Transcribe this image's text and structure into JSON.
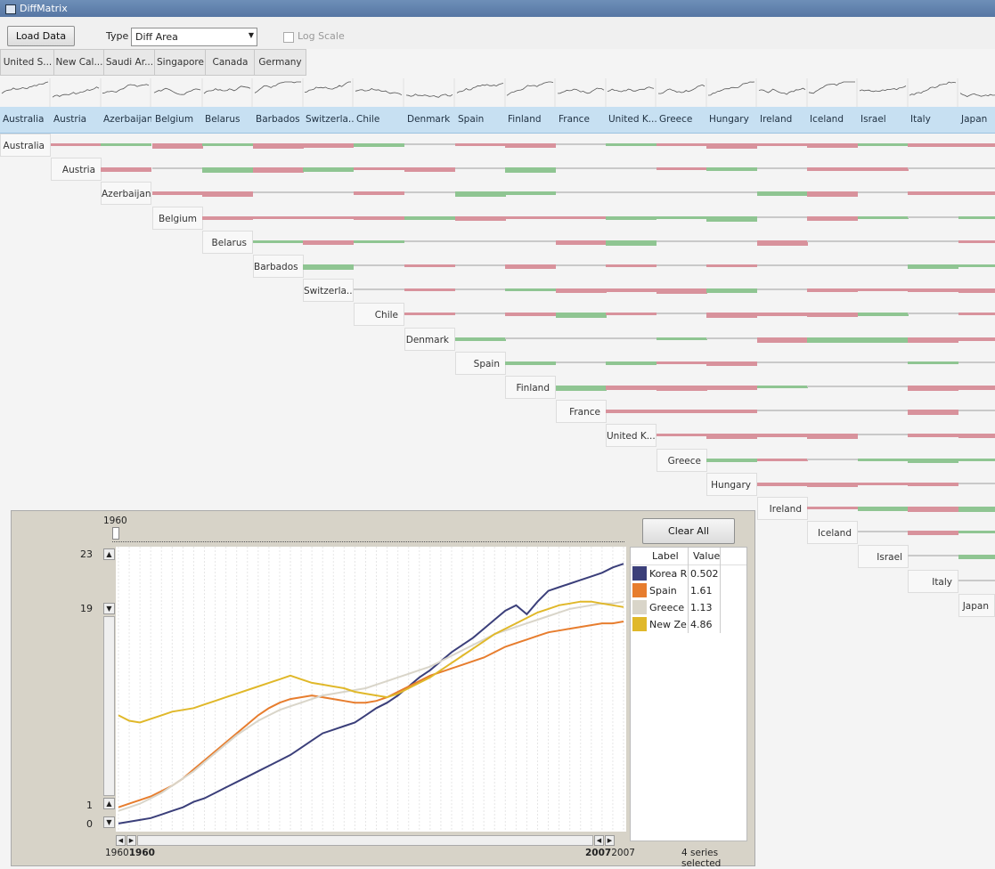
{
  "window": {
    "title": "DiffMatrix"
  },
  "toolbar": {
    "load_label": "Load Data",
    "type_label": "Type",
    "type_value": "Diff Area",
    "log_scale_label": "Log Scale"
  },
  "selected_tabs": [
    "United S...",
    "New Cal...",
    "Saudi Ar...",
    "Singapore",
    "Canada",
    "Germany"
  ],
  "columns": [
    "Australia",
    "Austria",
    "Azerbaijan",
    "Belgium",
    "Belarus",
    "Barbados",
    "Switzerla...",
    "Chile",
    "Denmark",
    "Spain",
    "Finland",
    "France",
    "United K...",
    "Greece",
    "Hungary",
    "Ireland",
    "Iceland",
    "Israel",
    "Italy",
    "Japan"
  ],
  "row_labels": [
    "Australia",
    "Austria",
    "Azerbaijan",
    "Belgium",
    "Belarus",
    "Barbados",
    "Switzerla...",
    "Chile",
    "Denmark",
    "Spain",
    "Finland",
    "France",
    "United K...",
    "Greece",
    "Hungary",
    "Ireland",
    "Iceland",
    "Israel",
    "Italy",
    "Japan"
  ],
  "colors": {
    "positive": "#d8929c",
    "negative": "#8fc592",
    "neutral": "#c9c9c9",
    "header": "#c7e0f2"
  },
  "detail": {
    "slider_label": "1960",
    "clear_label": "Clear All",
    "y_top": "23",
    "y_upper": "19",
    "y_lower": "1",
    "y_bottom": "0",
    "x_start_prefix": "1960",
    "x_start_bold": "1960",
    "x_end_bold": "2007",
    "x_end_suffix": "2007",
    "status": "4 series selected",
    "legend_header": {
      "label": "Label",
      "value": "Value"
    },
    "legend": [
      {
        "label": "Korea R",
        "value": "0.502",
        "color": "#3b3f7a"
      },
      {
        "label": "Spain",
        "value": "1.61",
        "color": "#e77d2e"
      },
      {
        "label": "Greece",
        "value": "1.13",
        "color": "#d9d5c9"
      },
      {
        "label": "New Ze",
        "value": "4.86",
        "color": "#e0b82a"
      }
    ]
  },
  "chart_data": {
    "type": "line",
    "x": [
      1960,
      1961,
      1962,
      1963,
      1964,
      1965,
      1966,
      1967,
      1968,
      1969,
      1970,
      1971,
      1972,
      1973,
      1974,
      1975,
      1976,
      1977,
      1978,
      1979,
      1980,
      1981,
      1982,
      1983,
      1984,
      1985,
      1986,
      1987,
      1988,
      1989,
      1990,
      1991,
      1992,
      1993,
      1994,
      1995,
      1996,
      1997,
      1998,
      1999,
      2000,
      2001,
      2002,
      2003,
      2004,
      2005,
      2006,
      2007
    ],
    "ylim": [
      0,
      23
    ],
    "series": [
      {
        "name": "Korea R",
        "color": "#3b3f7a",
        "values": [
          0.3,
          0.4,
          0.5,
          0.6,
          0.8,
          1.0,
          1.2,
          1.5,
          1.7,
          2.0,
          2.3,
          2.6,
          2.9,
          3.2,
          3.5,
          3.8,
          4.1,
          4.5,
          4.9,
          5.3,
          5.5,
          5.7,
          5.9,
          6.3,
          6.7,
          7.0,
          7.4,
          7.9,
          8.4,
          8.8,
          9.3,
          9.8,
          10.2,
          10.6,
          11.1,
          11.6,
          12.1,
          12.4,
          11.9,
          12.6,
          13.2,
          13.4,
          13.6,
          13.8,
          14.0,
          14.2,
          14.5,
          14.7
        ]
      },
      {
        "name": "Spain",
        "color": "#e77d2e",
        "values": [
          1.2,
          1.4,
          1.6,
          1.8,
          2.1,
          2.4,
          2.8,
          3.3,
          3.8,
          4.3,
          4.8,
          5.3,
          5.8,
          6.3,
          6.7,
          7.0,
          7.2,
          7.3,
          7.4,
          7.3,
          7.2,
          7.1,
          7.0,
          7.0,
          7.1,
          7.3,
          7.6,
          7.9,
          8.2,
          8.5,
          8.7,
          8.9,
          9.1,
          9.3,
          9.5,
          9.8,
          10.1,
          10.3,
          10.5,
          10.7,
          10.9,
          11.0,
          11.1,
          11.2,
          11.3,
          11.4,
          11.4,
          11.5
        ]
      },
      {
        "name": "Greece",
        "color": "#d9d5c9",
        "values": [
          1.0,
          1.2,
          1.4,
          1.7,
          2.0,
          2.4,
          2.8,
          3.2,
          3.7,
          4.2,
          4.7,
          5.2,
          5.6,
          6.0,
          6.3,
          6.6,
          6.8,
          7.0,
          7.2,
          7.4,
          7.5,
          7.6,
          7.7,
          7.8,
          8.0,
          8.2,
          8.4,
          8.6,
          8.8,
          9.0,
          9.3,
          9.6,
          9.9,
          10.2,
          10.5,
          10.8,
          11.0,
          11.2,
          11.4,
          11.6,
          11.8,
          12.0,
          12.2,
          12.3,
          12.4,
          12.5,
          12.5,
          12.6
        ]
      },
      {
        "name": "New Ze",
        "color": "#e0b82a",
        "values": [
          6.3,
          6.0,
          5.9,
          6.1,
          6.3,
          6.5,
          6.6,
          6.7,
          6.9,
          7.1,
          7.3,
          7.5,
          7.7,
          7.9,
          8.1,
          8.3,
          8.5,
          8.3,
          8.1,
          8.0,
          7.9,
          7.8,
          7.6,
          7.5,
          7.4,
          7.3,
          7.5,
          7.8,
          8.1,
          8.4,
          8.8,
          9.2,
          9.6,
          10.0,
          10.4,
          10.8,
          11.1,
          11.4,
          11.7,
          12.0,
          12.2,
          12.4,
          12.5,
          12.6,
          12.6,
          12.5,
          12.4,
          12.3
        ]
      }
    ]
  }
}
